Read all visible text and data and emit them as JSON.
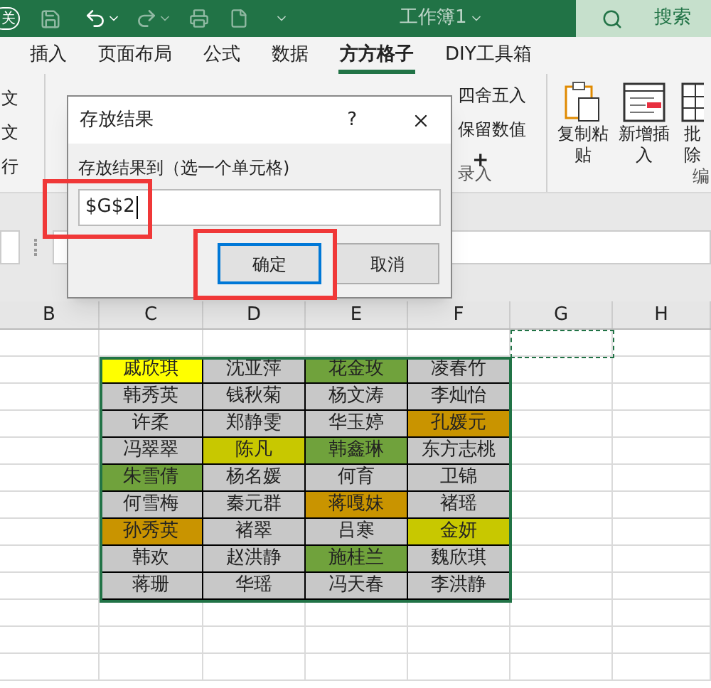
{
  "title_bar": {
    "badge": "关",
    "title": "工作簿1",
    "search": {
      "placeholder": "搜索"
    }
  },
  "ribbon_tabs": [
    {
      "label": "插入",
      "selected": false
    },
    {
      "label": "页面布局",
      "selected": false
    },
    {
      "label": "公式",
      "selected": false
    },
    {
      "label": "数据",
      "selected": false
    },
    {
      "label": "方方格子",
      "selected": true
    },
    {
      "label": "DIY工具箱",
      "selected": false
    }
  ],
  "ribbon": {
    "left_items": [
      "文",
      "文",
      "行"
    ],
    "small_items": [
      "四舍五入",
      "保留数值",
      "+"
    ],
    "group_label": "录入",
    "big_buttons": [
      {
        "line1": "复制粘",
        "line2": "贴",
        "kind": "paste"
      },
      {
        "line1": "新增插",
        "line2": "入",
        "kind": "insert"
      },
      {
        "line1": "批",
        "line2": "除",
        "kind": "grid"
      }
    ],
    "group_label_2": "编"
  },
  "sheet": {
    "columns": [
      "B",
      "C",
      "D",
      "E",
      "F",
      "G",
      "H"
    ],
    "rows": [
      [
        {
          "text": ""
        },
        {
          "text": "戚欣琪",
          "color": "#ffff00"
        },
        {
          "text": "沈亚萍",
          "color": "#c8c8c8"
        },
        {
          "text": "花金玫",
          "color": "#70a23c"
        },
        {
          "text": "凌春竹",
          "color": "#c8c8c8"
        }
      ],
      [
        {
          "text": ""
        },
        {
          "text": "韩秀英",
          "color": "#c8c8c8"
        },
        {
          "text": "钱秋菊",
          "color": "#c8c8c8"
        },
        {
          "text": "杨文涛",
          "color": "#c8c8c8"
        },
        {
          "text": "李灿怡",
          "color": "#c8c8c8"
        }
      ],
      [
        {
          "text": ""
        },
        {
          "text": "许柔",
          "color": "#c8c8c8"
        },
        {
          "text": "郑静雯",
          "color": "#c8c8c8"
        },
        {
          "text": "华玉婷",
          "color": "#c8c8c8"
        },
        {
          "text": "孔媛元",
          "color": "#c99400"
        }
      ],
      [
        {
          "text": ""
        },
        {
          "text": "冯翠翠",
          "color": "#c8c8c8"
        },
        {
          "text": "陈凡",
          "color": "#c8c800"
        },
        {
          "text": "韩鑫琳",
          "color": "#70a23c"
        },
        {
          "text": "东方志桃",
          "color": "#c8c8c8"
        }
      ],
      [
        {
          "text": ""
        },
        {
          "text": "朱雪倩",
          "color": "#70a23c"
        },
        {
          "text": "杨名媛",
          "color": "#c8c8c8"
        },
        {
          "text": "何育",
          "color": "#c8c8c8"
        },
        {
          "text": "卫锦",
          "color": "#c8c8c8"
        }
      ],
      [
        {
          "text": ""
        },
        {
          "text": "何雪梅",
          "color": "#c8c8c8"
        },
        {
          "text": "秦元群",
          "color": "#c8c8c8"
        },
        {
          "text": "蒋嘎妹",
          "color": "#c99400"
        },
        {
          "text": "褚瑶",
          "color": "#c8c8c8"
        }
      ],
      [
        {
          "text": ""
        },
        {
          "text": "孙秀英",
          "color": "#c99400"
        },
        {
          "text": "褚翠",
          "color": "#c8c8c8"
        },
        {
          "text": "吕寒",
          "color": "#c8c8c8"
        },
        {
          "text": "金妍",
          "color": "#c8c800"
        }
      ],
      [
        {
          "text": ""
        },
        {
          "text": "韩欢",
          "color": "#c8c8c8"
        },
        {
          "text": "赵洪静",
          "color": "#c8c8c8"
        },
        {
          "text": "施桂兰",
          "color": "#70a23c"
        },
        {
          "text": "魏欣琪",
          "color": "#c8c8c8"
        }
      ],
      [
        {
          "text": ""
        },
        {
          "text": "蒋珊",
          "color": "#c8c8c8"
        },
        {
          "text": "华瑶",
          "color": "#c8c8c8"
        },
        {
          "text": "冯天春",
          "color": "#c8c8c8"
        },
        {
          "text": "李洪静",
          "color": "#c8c8c8"
        }
      ]
    ]
  },
  "dialog": {
    "title": "存放结果",
    "help": "?",
    "label": "存放结果到（选一个单元格)",
    "input": {
      "value": "$G$2"
    },
    "buttons": [
      {
        "label": "确定",
        "focused": true
      },
      {
        "label": "取消",
        "focused": false
      }
    ]
  }
}
